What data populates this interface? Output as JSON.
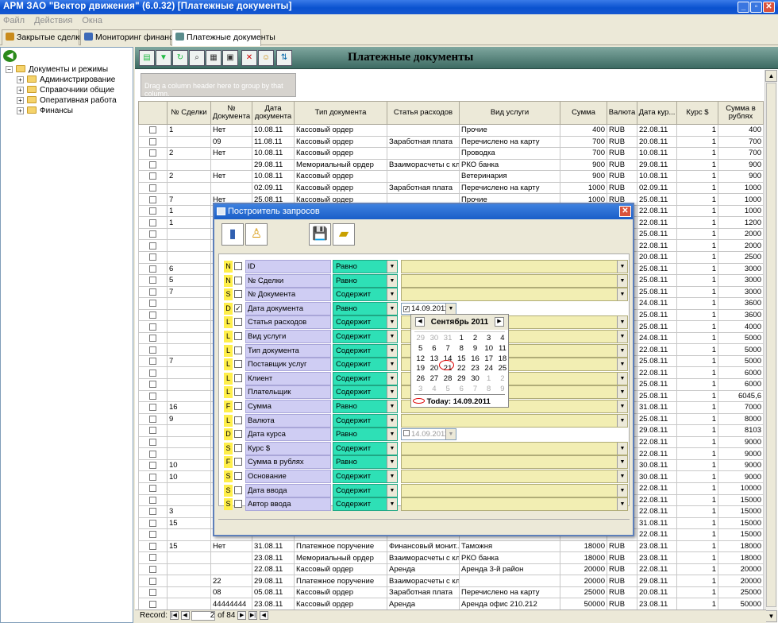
{
  "app": {
    "title": "АРМ ЗАО \"Вектор движения\" (6.0.32)  [Платежные документы]",
    "menu": [
      "Файл",
      "Действия",
      "Окна"
    ]
  },
  "tabs": [
    {
      "label": "Закрытые сделки",
      "color": "#c98b1c"
    },
    {
      "label": "Мониторинг финансов",
      "color": "#3d6ab8"
    },
    {
      "label": "Платежные документы",
      "color": "#5a8c8c",
      "active": true
    }
  ],
  "tree": {
    "root": "Документы и режимы",
    "children": [
      "Администрирование",
      "Справочники общие",
      "Оперативная работа",
      "Финансы"
    ]
  },
  "main": {
    "title": "Платежные документы",
    "group_hint": "Drag a column header here to group by that column.",
    "toolbar_icons": [
      "save-icon",
      "filter-icon",
      "refresh-icon",
      "find-icon",
      "print-icon",
      "form-icon",
      "delete-icon",
      "user-icon",
      "export-icon"
    ]
  },
  "grid": {
    "columns": [
      "",
      "№ Сделки",
      "№ Документа",
      "Дата документа",
      "Тип документа",
      "Статья расходов",
      "Вид услуги",
      "Сумма",
      "Валюта",
      "Дата кур...",
      "Курс $",
      "Сумма в рублях"
    ],
    "rows": [
      [
        "",
        "1",
        "Нет",
        "10.08.11",
        "Кассовый ордер",
        "",
        "Прочие",
        "400",
        "RUB",
        "22.08.11",
        "1",
        "400"
      ],
      [
        "",
        "",
        "09",
        "11.08.11",
        "Кассовый ордер",
        "Заработная плата",
        "Перечислено на карту",
        "700",
        "RUB",
        "20.08.11",
        "1",
        "700"
      ],
      [
        "",
        "2",
        "Нет",
        "10.08.11",
        "Кассовый ордер",
        "",
        "Проводка",
        "700",
        "RUB",
        "10.08.11",
        "1",
        "700"
      ],
      [
        "",
        "",
        "",
        "29.08.11",
        "Мемориальный ордер",
        "Взаиморасчеты с кл...",
        "РКО банка",
        "900",
        "RUB",
        "29.08.11",
        "1",
        "900"
      ],
      [
        "",
        "2",
        "Нет",
        "10.08.11",
        "Кассовый ордер",
        "",
        "Ветеринария",
        "900",
        "RUB",
        "10.08.11",
        "1",
        "900"
      ],
      [
        "",
        "",
        "",
        "02.09.11",
        "Кассовый ордер",
        "Заработная плата",
        "Перечислено на карту",
        "1000",
        "RUB",
        "02.09.11",
        "1",
        "1000"
      ],
      [
        "",
        "7",
        "Нет",
        "25.08.11",
        "Кассовый ордер",
        "",
        "Прочие",
        "1000",
        "RUB",
        "25.08.11",
        "1",
        "1000"
      ],
      [
        "",
        "1",
        "",
        "",
        "",
        "",
        "",
        "",
        "",
        "22.08.11",
        "1",
        "1000"
      ],
      [
        "",
        "1",
        "",
        "",
        "",
        "",
        "",
        "",
        "",
        "22.08.11",
        "1",
        "1200"
      ],
      [
        "",
        "",
        "",
        "",
        "",
        "",
        "",
        "",
        "",
        "25.08.11",
        "1",
        "2000"
      ],
      [
        "",
        "",
        "",
        "",
        "",
        "",
        "",
        "",
        "",
        "22.08.11",
        "1",
        "2000"
      ],
      [
        "",
        "",
        "",
        "",
        "",
        "",
        "",
        "",
        "",
        "20.08.11",
        "1",
        "2500"
      ],
      [
        "",
        "6",
        "",
        "",
        "",
        "",
        "",
        "",
        "",
        "25.08.11",
        "1",
        "3000"
      ],
      [
        "",
        "5",
        "",
        "",
        "",
        "",
        "",
        "",
        "",
        "25.08.11",
        "1",
        "3000"
      ],
      [
        "",
        "7",
        "",
        "",
        "",
        "",
        "",
        "",
        "",
        "25.08.11",
        "1",
        "3000"
      ],
      [
        "",
        "",
        "",
        "",
        "",
        "",
        "",
        "",
        "",
        "24.08.11",
        "1",
        "3600"
      ],
      [
        "",
        "",
        "",
        "",
        "",
        "",
        "",
        "",
        "",
        "25.08.11",
        "1",
        "3600"
      ],
      [
        "",
        "",
        "",
        "",
        "",
        "",
        "",
        "",
        "",
        "25.08.11",
        "1",
        "4000"
      ],
      [
        "",
        "",
        "",
        "",
        "",
        "",
        "",
        "",
        "",
        "24.08.11",
        "1",
        "5000"
      ],
      [
        "",
        "",
        "",
        "",
        "",
        "",
        "",
        "",
        "",
        "22.08.11",
        "1",
        "5000"
      ],
      [
        "",
        "7",
        "",
        "",
        "",
        "",
        "",
        "",
        "",
        "25.08.11",
        "1",
        "5000"
      ],
      [
        "",
        "",
        "",
        "",
        "",
        "",
        "",
        "",
        "",
        "22.08.11",
        "1",
        "6000"
      ],
      [
        "",
        "",
        "",
        "",
        "",
        "",
        "",
        "",
        "",
        "25.08.11",
        "1",
        "6000"
      ],
      [
        "",
        "",
        "",
        "",
        "",
        "",
        "",
        "",
        "",
        "25.08.11",
        "1",
        "6045,6"
      ],
      [
        "",
        "16",
        "",
        "",
        "",
        "",
        "",
        "",
        "",
        "31.08.11",
        "1",
        "7000"
      ],
      [
        "",
        "9",
        "",
        "",
        "",
        "",
        "",
        "",
        "",
        "25.08.11",
        "1",
        "8000"
      ],
      [
        "",
        "",
        "",
        "",
        "",
        "",
        "",
        "",
        "",
        "29.08.11",
        "1",
        "8103"
      ],
      [
        "",
        "",
        "",
        "",
        "",
        "",
        "",
        "",
        "",
        "22.08.11",
        "1",
        "9000"
      ],
      [
        "",
        "",
        "",
        "",
        "",
        "",
        "",
        "",
        "",
        "22.08.11",
        "1",
        "9000"
      ],
      [
        "",
        "10",
        "",
        "",
        "",
        "",
        "",
        "",
        "",
        "30.08.11",
        "1",
        "9000"
      ],
      [
        "",
        "10",
        "",
        "",
        "",
        "",
        "",
        "",
        "",
        "30.08.11",
        "1",
        "9000"
      ],
      [
        "",
        "",
        "",
        "",
        "",
        "",
        "",
        "",
        "",
        "22.08.11",
        "1",
        "10000"
      ],
      [
        "",
        "",
        "",
        "",
        "",
        "",
        "",
        "",
        "",
        "22.08.11",
        "1",
        "15000"
      ],
      [
        "",
        "3",
        "",
        "",
        "",
        "",
        "",
        "",
        "",
        "22.08.11",
        "1",
        "15000"
      ],
      [
        "",
        "15",
        "",
        "",
        "",
        "",
        "",
        "",
        "",
        "31.08.11",
        "1",
        "15000"
      ],
      [
        "",
        "",
        "",
        "",
        "",
        "",
        "",
        "",
        "",
        "22.08.11",
        "1",
        "15000"
      ],
      [
        "",
        "15",
        "Нет",
        "31.08.11",
        "Платежное поручение",
        "Финансовый монит...",
        "Таможня",
        "18000",
        "RUB",
        "23.08.11",
        "1",
        "18000"
      ],
      [
        "",
        "",
        "",
        "23.08.11",
        "Мемориальный ордер",
        "Взаиморасчеты с кл...",
        "РКО банка",
        "18000",
        "RUB",
        "23.08.11",
        "1",
        "18000"
      ],
      [
        "",
        "",
        "",
        "22.08.11",
        "Кассовый ордер",
        "Аренда",
        "Аренда 3-й район",
        "20000",
        "RUB",
        "22.08.11",
        "1",
        "20000"
      ],
      [
        "",
        "",
        "22",
        "29.08.11",
        "Платежное поручение",
        "Взаиморасчеты с кл...",
        "",
        "20000",
        "RUB",
        "29.08.11",
        "1",
        "20000"
      ],
      [
        "",
        "",
        "08",
        "05.08.11",
        "Кассовый ордер",
        "Заработная плата",
        "Перечислено на карту",
        "25000",
        "RUB",
        "20.08.11",
        "1",
        "25000"
      ],
      [
        "",
        "",
        "44444444",
        "23.08.11",
        "Кассовый ордер",
        "Аренда",
        "Аренда офис 210.212",
        "50000",
        "RUB",
        "23.08.11",
        "1",
        "50000"
      ]
    ]
  },
  "status": {
    "record_label": "Record:",
    "current": "2",
    "of": "of 84"
  },
  "dialog": {
    "title": "Построитель запросов",
    "fields": [
      {
        "type": "N",
        "name": "ID",
        "op": "Равно",
        "checked": false
      },
      {
        "type": "N",
        "name": "№ Сделки",
        "op": "Равно",
        "checked": false
      },
      {
        "type": "S",
        "name": "№ Документа",
        "op": "Содержит",
        "checked": false
      },
      {
        "type": "D",
        "name": "Дата документа",
        "op": "Равно",
        "checked": true,
        "date": "14.09.2011",
        "date_enabled": true
      },
      {
        "type": "L",
        "name": "Статья расходов",
        "op": "Содержит",
        "checked": false
      },
      {
        "type": "L",
        "name": "Вид услуги",
        "op": "Содержит",
        "checked": false
      },
      {
        "type": "L",
        "name": "Тип документа",
        "op": "Содержит",
        "checked": false
      },
      {
        "type": "L",
        "name": "Поставщик услуг",
        "op": "Содержит",
        "checked": false
      },
      {
        "type": "L",
        "name": "Клиент",
        "op": "Содержит",
        "checked": false
      },
      {
        "type": "L",
        "name": "Плательщик",
        "op": "Содержит",
        "checked": false
      },
      {
        "type": "F",
        "name": "Сумма",
        "op": "Равно",
        "checked": false
      },
      {
        "type": "L",
        "name": "Валюта",
        "op": "Содержит",
        "checked": false
      },
      {
        "type": "D",
        "name": "Дата курса",
        "op": "Равно",
        "checked": false,
        "date": "14.09.2011",
        "date_enabled": false
      },
      {
        "type": "S",
        "name": "Курс $",
        "op": "Содержит",
        "checked": false
      },
      {
        "type": "F",
        "name": "Сумма в рублях",
        "op": "Равно",
        "checked": false
      },
      {
        "type": "S",
        "name": "Основание",
        "op": "Содержит",
        "checked": false
      },
      {
        "type": "S",
        "name": "Дата ввода",
        "op": "Содержит",
        "checked": false
      },
      {
        "type": "S",
        "name": "Автор ввода",
        "op": "Содержит",
        "checked": false
      }
    ]
  },
  "calendar": {
    "month_label": "Сентябрь 2011",
    "weeks": [
      [
        [
          "29",
          1
        ],
        [
          "30",
          1
        ],
        [
          "31",
          1
        ],
        [
          "1",
          0
        ],
        [
          "2",
          0
        ],
        [
          "3",
          0
        ],
        [
          "4",
          0
        ]
      ],
      [
        [
          "5",
          0
        ],
        [
          "6",
          0
        ],
        [
          "7",
          0
        ],
        [
          "8",
          0
        ],
        [
          "9",
          0
        ],
        [
          "10",
          0
        ],
        [
          "11",
          0
        ]
      ],
      [
        [
          "12",
          0
        ],
        [
          "13",
          0
        ],
        [
          "14",
          0
        ],
        [
          "15",
          0
        ],
        [
          "16",
          0
        ],
        [
          "17",
          0
        ],
        [
          "18",
          0
        ]
      ],
      [
        [
          "19",
          0
        ],
        [
          "20",
          0
        ],
        [
          "21",
          0
        ],
        [
          "22",
          0
        ],
        [
          "23",
          0
        ],
        [
          "24",
          0
        ],
        [
          "25",
          0
        ]
      ],
      [
        [
          "26",
          0
        ],
        [
          "27",
          0
        ],
        [
          "28",
          0
        ],
        [
          "29",
          0
        ],
        [
          "30",
          0
        ],
        [
          "1",
          1
        ],
        [
          "2",
          1
        ]
      ],
      [
        [
          "3",
          1
        ],
        [
          "4",
          1
        ],
        [
          "5",
          1
        ],
        [
          "6",
          1
        ],
        [
          "7",
          1
        ],
        [
          "8",
          1
        ],
        [
          "9",
          1
        ]
      ]
    ],
    "today_label": "Today: 14.09.2011"
  }
}
